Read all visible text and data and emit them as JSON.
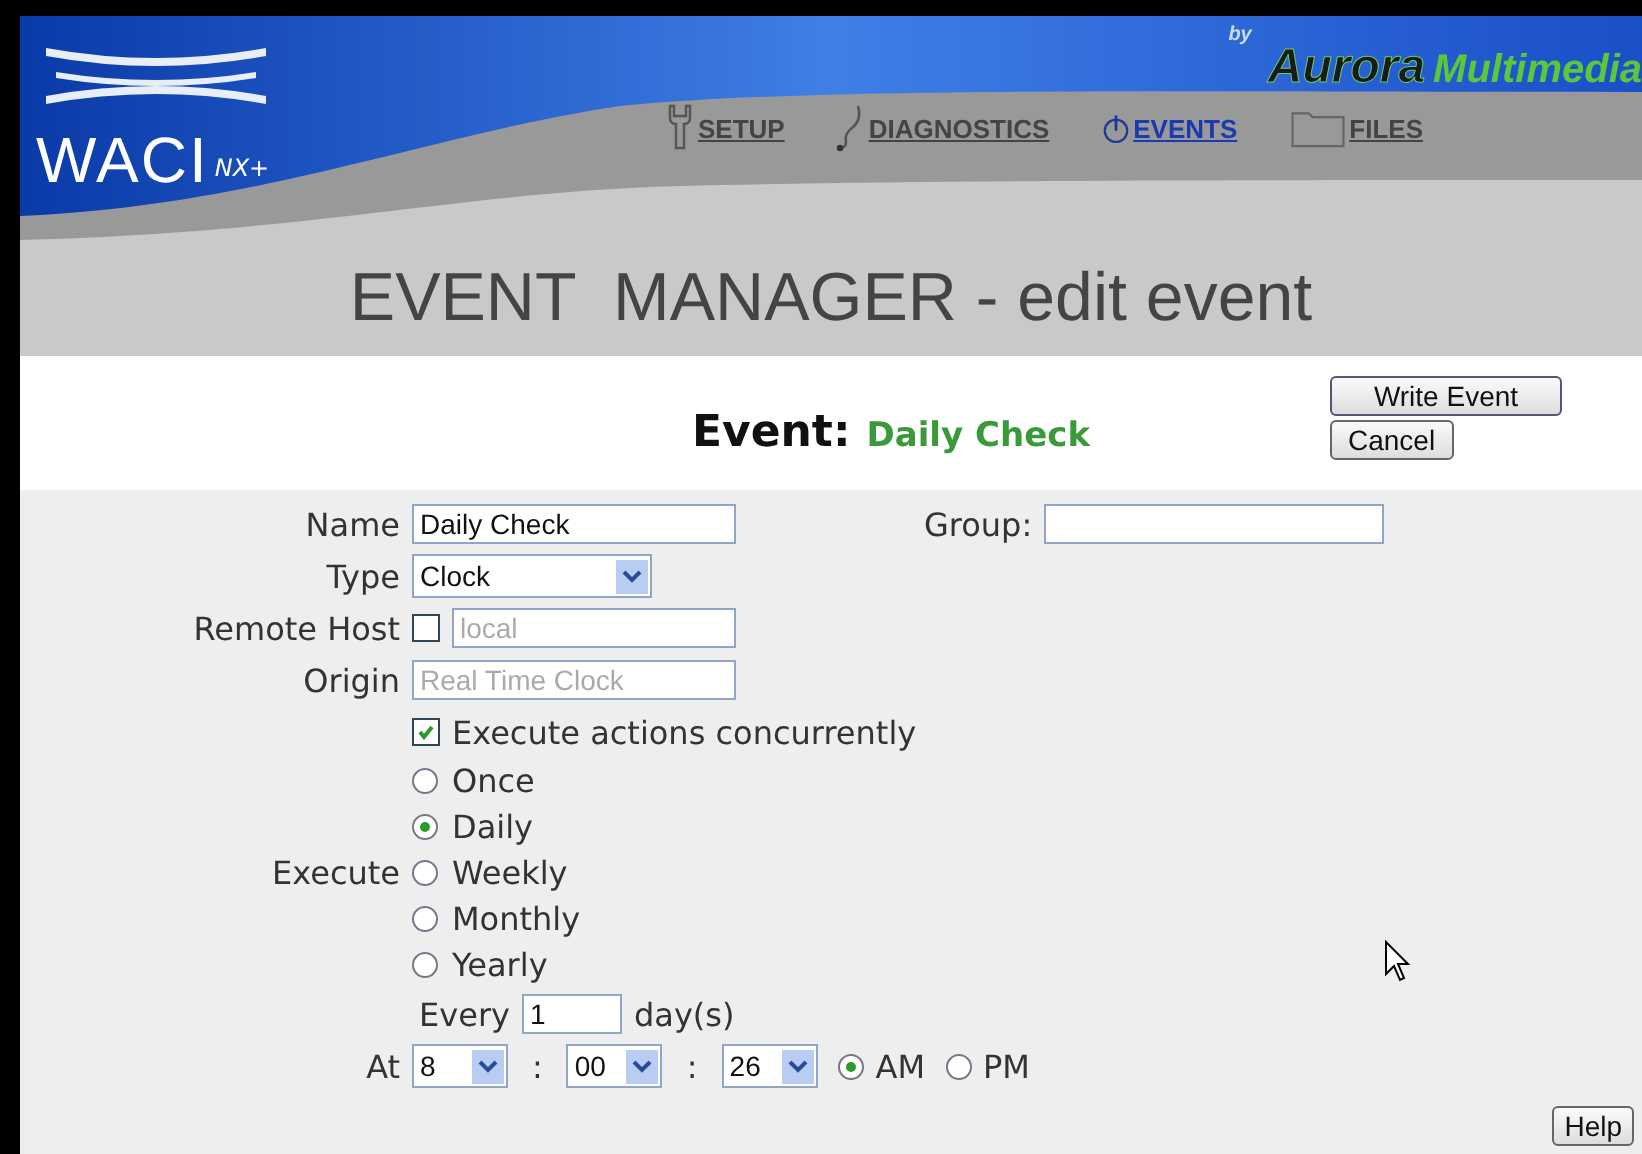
{
  "header": {
    "logo": "WACI",
    "logo_suffix": "NX+",
    "brand_by": "by",
    "brand_name": "Aurora",
    "brand_sub": "Multimedia",
    "nav": [
      {
        "label": "SETUP",
        "selected": false
      },
      {
        "label": "DIAGNOSTICS",
        "selected": false
      },
      {
        "label": "EVENTS",
        "selected": true
      },
      {
        "label": "FILES",
        "selected": false
      }
    ]
  },
  "page_title": {
    "main": "EVENT  MANAGER",
    "sub": " - edit event"
  },
  "event": {
    "label": "Event:",
    "name": "Daily Check"
  },
  "buttons": {
    "write": "Write Event",
    "cancel": "Cancel",
    "help": "Help"
  },
  "form": {
    "name": {
      "label": "Name",
      "value": "Daily Check"
    },
    "group": {
      "label": "Group:"
    },
    "type": {
      "label": "Type",
      "value": "Clock"
    },
    "remote_host": {
      "label": "Remote Host",
      "checked": false,
      "value": "local",
      "disabled": true
    },
    "origin": {
      "label": "Origin",
      "value": "Real Time Clock",
      "disabled": true
    },
    "concurrent": {
      "label": "Execute actions concurrently",
      "checked": true
    },
    "execute": {
      "label": "Execute",
      "options": [
        {
          "label": "Once",
          "selected": false
        },
        {
          "label": "Daily",
          "selected": true
        },
        {
          "label": "Weekly",
          "selected": false
        },
        {
          "label": "Monthly",
          "selected": false
        },
        {
          "label": "Yearly",
          "selected": false
        }
      ]
    },
    "every": {
      "label": "Every",
      "value": "1",
      "unit": "day(s)"
    },
    "at": {
      "label": "At",
      "hour": "8",
      "minute": "00",
      "second": "26",
      "sep1": ":",
      "sep2": ":",
      "ampm": [
        {
          "label": "AM",
          "selected": true
        },
        {
          "label": "PM",
          "selected": false
        }
      ]
    }
  }
}
